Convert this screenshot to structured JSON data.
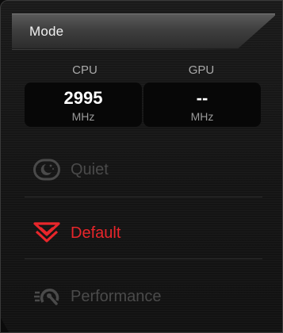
{
  "header": {
    "title": "Mode"
  },
  "metrics": {
    "cpu": {
      "label": "CPU",
      "value": "2995",
      "unit": "MHz"
    },
    "gpu": {
      "label": "GPU",
      "value": "--",
      "unit": "MHz"
    }
  },
  "modes": [
    {
      "label": "Quiet",
      "icon": "moon-gauge-icon",
      "state": "inactive"
    },
    {
      "label": "Default",
      "icon": "chevron-shield-icon",
      "state": "active"
    },
    {
      "label": "Performance",
      "icon": "turbo-gauge-icon",
      "state": "inactive"
    }
  ],
  "colors": {
    "accent": "#e8262b",
    "inactive": "#4a4a4a",
    "background": "#141414",
    "value_box": "#070707"
  }
}
